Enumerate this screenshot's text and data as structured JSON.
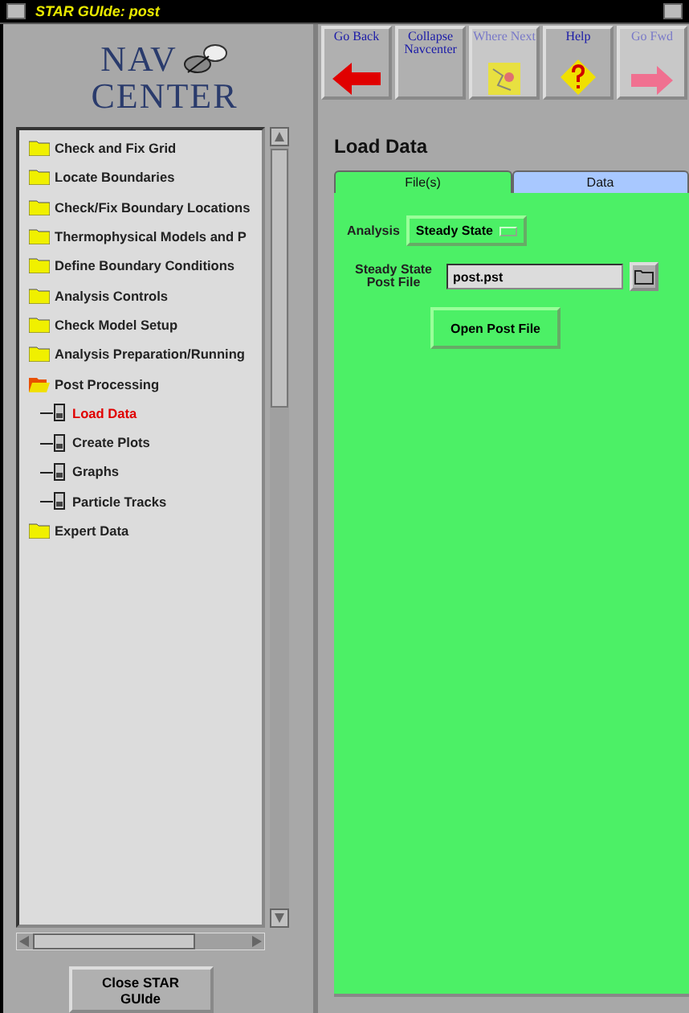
{
  "window": {
    "title": "STAR GUIde: post"
  },
  "logo": {
    "line_1": "NAV",
    "line_2": "CENTER"
  },
  "toolbar": [
    {
      "kind": "back",
      "label": "Go Back",
      "disabled": false
    },
    {
      "kind": "collapse",
      "label": "Collapse Navcenter",
      "disabled": false
    },
    {
      "kind": "where",
      "label": "Where Next",
      "disabled": true
    },
    {
      "kind": "help",
      "label": "Help",
      "disabled": false
    },
    {
      "kind": "forward",
      "label": "Go Fwd",
      "disabled": true
    }
  ],
  "tree": [
    {
      "label": "Check and Fix Grid",
      "expanded": false,
      "selected": false
    },
    {
      "label": "Locate Boundaries",
      "expanded": false,
      "selected": false
    },
    {
      "label": "Check/Fix Boundary Locations",
      "expanded": false,
      "selected": false
    },
    {
      "label": "Thermophysical Models and P",
      "expanded": false,
      "selected": false
    },
    {
      "label": "Define Boundary Conditions",
      "expanded": false,
      "selected": false
    },
    {
      "label": "Analysis Controls",
      "expanded": false,
      "selected": false
    },
    {
      "label": "Check Model Setup",
      "expanded": false,
      "selected": false
    },
    {
      "label": "Analysis Preparation/Running",
      "expanded": false,
      "selected": false
    },
    {
      "label": "Post Processing",
      "expanded": true,
      "selected": false,
      "children": [
        {
          "label": "Load Data",
          "selected": true
        },
        {
          "label": "Create Plots",
          "selected": false
        },
        {
          "label": "Graphs",
          "selected": false
        },
        {
          "label": "Particle Tracks",
          "selected": false
        }
      ]
    },
    {
      "label": "Expert Data",
      "expanded": false,
      "selected": false
    }
  ],
  "close_button": "Close STAR GUIde",
  "panel": {
    "title": "Load Data",
    "tabs": [
      {
        "label": "File(s)",
        "selected": true
      },
      {
        "label": "Data",
        "selected": false
      }
    ],
    "analysis": {
      "label": "Analysis",
      "value": "Steady State"
    },
    "post_file": {
      "label_1": "Steady State",
      "label_2": "Post File",
      "value": "post.pst"
    },
    "open_button": "Open Post File"
  }
}
